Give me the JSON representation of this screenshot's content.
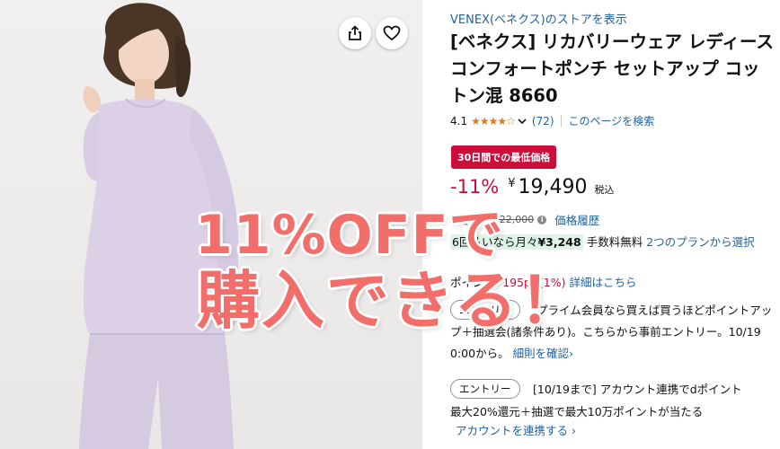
{
  "store": {
    "link": "VENEX(ベネクス)のストアを表示"
  },
  "product": {
    "title": "[ベネクス] リカバリーウェア レディース コンフォートポンチ セットアップ コットン混 8660"
  },
  "rating": {
    "value": "4.1",
    "stars": "★★★★☆",
    "review_count": "(72)",
    "search_page": "このページを検索"
  },
  "badge": {
    "label": "30日間での最低価格"
  },
  "price": {
    "discount": "-11%",
    "currency": "¥",
    "amount": "19,490",
    "tax": "税込"
  },
  "reference": {
    "label": "参考価格:",
    "price": "¥22,000",
    "info": "i",
    "history_link": "価格履歴"
  },
  "installment": {
    "prefix": "6回払いなら月々",
    "monthly": "¥3,248",
    "fee_text": "手数料無料",
    "plans_link": "2つのプランから選択"
  },
  "points": {
    "label": "ポイント:",
    "value": "195pt",
    "percent": "(1%)",
    "detail_link": "詳細はこちら"
  },
  "promo1": {
    "entry": "エントリー",
    "text": "プライム会員なら買えば買うほどポイントアップ＋抽選会(諸条件あり)。こちらから事前エントリー。10/19 0:00から。",
    "link": "細則を確認›"
  },
  "promo2": {
    "entry": "エントリー",
    "text": "[10/19まで] アカウント連携でdポイント",
    "line2": "最大20%還元＋抽選で最大10万ポイントが当たる",
    "link": "アカウントを連携する ›"
  },
  "overlay": {
    "line1": "11%OFFで",
    "line2": "購入できる！"
  },
  "icons": {
    "share": "share-icon",
    "wishlist": "heart-icon"
  },
  "colors": {
    "accent_red": "#cc0c39",
    "link_blue": "#2162a1",
    "star_orange": "#de7921",
    "overlay_coral": "#f26e6a"
  }
}
